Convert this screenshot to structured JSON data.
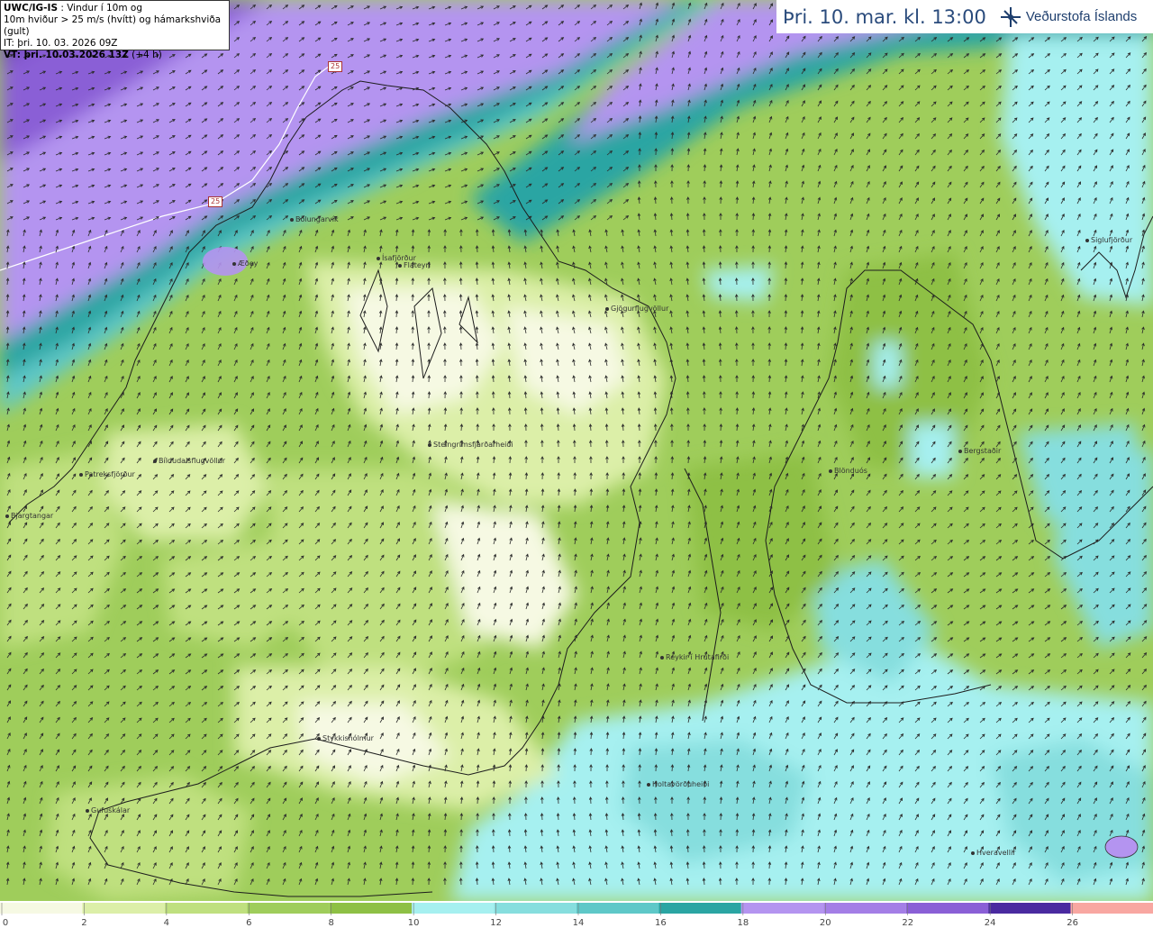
{
  "header": {
    "model_id": "UWC/IG-IS",
    "title_line1_rest": " : Vindur í 10m og",
    "title_line2": "10m hviður > 25 m/s (hvítt) og hámarkshviða (gult)",
    "it_line": "IT: þri. 10. 03. 2026 09Z",
    "vt_label": "VT: þri. 10.03.2026 13Z",
    "vt_offset": " (+4 h)"
  },
  "valid_time": "Þri. 10. mar. kl. 13:00",
  "logo": {
    "text": "Veðurstofa Íslands",
    "icon": "snowflake-star-icon"
  },
  "legend": {
    "ticks": [
      "0",
      "2",
      "4",
      "6",
      "8",
      "10",
      "12",
      "14",
      "16",
      "18",
      "20",
      "22",
      "24",
      "26"
    ],
    "colors": [
      "#f6f9e3",
      "#dcefa8",
      "#bfe07f",
      "#9fcd5b",
      "#8ec045",
      "#a6f0f0",
      "#86dede",
      "#5ec8c8",
      "#2aa5a3",
      "#b494f0",
      "#a47ee6",
      "#8a5fd6",
      "#4a2aa0",
      "#f8a7a1",
      "#ea6e6e"
    ]
  },
  "gust_isolines": [
    {
      "label": "25"
    },
    {
      "label": "25"
    }
  ],
  "places": [
    {
      "name": "Bolungarvík"
    },
    {
      "name": "Æðey"
    },
    {
      "name": "Ísafjörður"
    },
    {
      "name": "Flateyri"
    },
    {
      "name": "Gjögurflugvöllur"
    },
    {
      "name": "Siglufjörður"
    },
    {
      "name": "Steingrímsfjarðarheiði"
    },
    {
      "name": "Bíldudalsflugvöllur"
    },
    {
      "name": "Patreksfjörður"
    },
    {
      "name": "Bjargtangar"
    },
    {
      "name": "Blönduós"
    },
    {
      "name": "Bergstaðir"
    },
    {
      "name": "Reykir í Hrútafirði"
    },
    {
      "name": "Stykkishólmur"
    },
    {
      "name": "Holtavörðuheiði"
    },
    {
      "name": "Gufuskálar"
    },
    {
      "name": "Hveravellir"
    }
  ]
}
